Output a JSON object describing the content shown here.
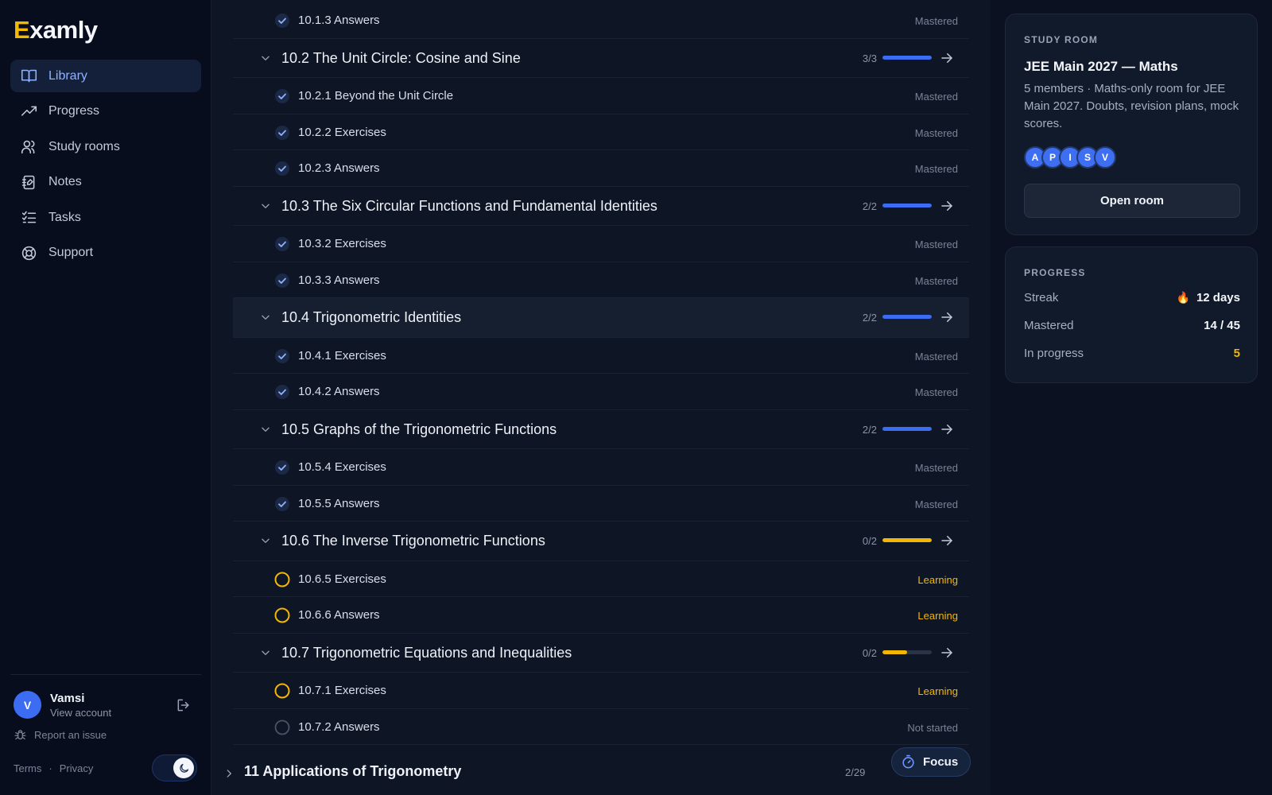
{
  "app": {
    "name": "Examly",
    "logo_first": "E",
    "logo_rest": "xamly"
  },
  "sidebar": {
    "items": [
      {
        "label": "Library",
        "icon": "book-icon",
        "active": true
      },
      {
        "label": "Progress",
        "icon": "trending-up-icon"
      },
      {
        "label": "Study rooms",
        "icon": "users-icon"
      },
      {
        "label": "Notes",
        "icon": "notebook-icon"
      },
      {
        "label": "Tasks",
        "icon": "checklist-icon"
      },
      {
        "label": "Support",
        "icon": "lifebuoy-icon"
      }
    ],
    "user": {
      "initial": "V",
      "name": "Vamsi",
      "sub": "View account"
    },
    "report": "Report an issue",
    "terms": "Terms",
    "dot": "·",
    "privacy": "Privacy"
  },
  "list": {
    "top_item": {
      "title": "10.1.3 Answers",
      "status": "Mastered"
    },
    "sections": [
      {
        "title": "10.2 The Unit Circle: Cosine and Sine",
        "count": "3/3",
        "progress": 1.0,
        "bar_color": "#3b6cf2",
        "items": [
          {
            "title": "10.2.1 Beyond the Unit Circle",
            "status": "Mastered",
            "state": "mastered"
          },
          {
            "title": "10.2.2 Exercises",
            "status": "Mastered",
            "state": "mastered"
          },
          {
            "title": "10.2.3 Answers",
            "status": "Mastered",
            "state": "mastered"
          }
        ]
      },
      {
        "title": "10.3 The Six Circular Functions and Fundamental Identities",
        "count": "2/2",
        "progress": 1.0,
        "bar_color": "#3b6cf2",
        "items": [
          {
            "title": "10.3.2 Exercises",
            "status": "Mastered",
            "state": "mastered"
          },
          {
            "title": "10.3.3 Answers",
            "status": "Mastered",
            "state": "mastered"
          }
        ]
      },
      {
        "title": "10.4 Trigonometric Identities",
        "count": "2/2",
        "progress": 1.0,
        "bar_color": "#3b6cf2",
        "highlight": true,
        "items": [
          {
            "title": "10.4.1 Exercises",
            "status": "Mastered",
            "state": "mastered"
          },
          {
            "title": "10.4.2 Answers",
            "status": "Mastered",
            "state": "mastered"
          }
        ]
      },
      {
        "title": "10.5 Graphs of the Trigonometric Functions",
        "count": "2/2",
        "progress": 1.0,
        "bar_color": "#3b6cf2",
        "items": [
          {
            "title": "10.5.4 Exercises",
            "status": "Mastered",
            "state": "mastered"
          },
          {
            "title": "10.5.5 Answers",
            "status": "Mastered",
            "state": "mastered"
          }
        ]
      },
      {
        "title": "10.6 The Inverse Trigonometric Functions",
        "count": "0/2",
        "progress": 1.0,
        "bar_color": "#f2b705",
        "items": [
          {
            "title": "10.6.5 Exercises",
            "status": "Learning",
            "state": "learning"
          },
          {
            "title": "10.6.6 Answers",
            "status": "Learning",
            "state": "learning"
          }
        ]
      },
      {
        "title": "10.7 Trigonometric Equations and Inequalities",
        "count": "0/2",
        "progress": 0.5,
        "bar_color": "#f2b705",
        "items": [
          {
            "title": "10.7.1 Exercises",
            "status": "Learning",
            "state": "learning"
          },
          {
            "title": "10.7.2 Answers",
            "status": "Not started",
            "state": "not-started"
          }
        ]
      }
    ],
    "chapter": {
      "title": "11 Applications of Trigonometry",
      "count": "2/29"
    }
  },
  "focus": {
    "label": "Focus"
  },
  "study_room": {
    "label": "STUDY ROOM",
    "title": "JEE Main 2027 — Maths",
    "description": "5 members · Maths-only room for JEE Main 2027. Doubts, revision plans, mock scores.",
    "members": [
      "A",
      "P",
      "I",
      "S",
      "V"
    ],
    "button": "Open room"
  },
  "progress_card": {
    "label": "PROGRESS",
    "streak_label": "Streak",
    "streak_value": "12 days",
    "mastered_label": "Mastered",
    "mastered_value": "14 / 45",
    "in_progress_label": "In progress",
    "in_progress_value": "5"
  },
  "colors": {
    "accent": "#3b6cf2",
    "learning": "#f2b705",
    "brand_e": "#f5b800"
  }
}
